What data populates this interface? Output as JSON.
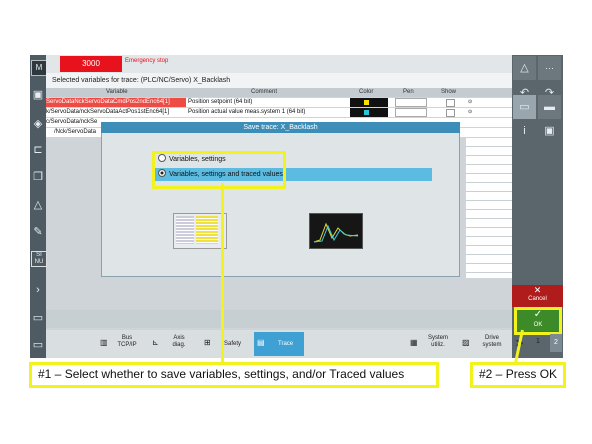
{
  "status": {
    "counter": "3000",
    "alarm": "Emergency stop"
  },
  "trace": {
    "title": "Selected variables for trace: (PLC/NC/Servo) X_Backlash",
    "columns": [
      "Variable",
      "Comment",
      "Color",
      "Pen",
      "Show"
    ],
    "rows": [
      {
        "variable": "ServoDataNckServoDataCmdPos2ndEnc64[1]",
        "comment": "Position setpoint (64 bit)"
      },
      {
        "variable": "k/ServoData/nckServoDataActPos1stEnc64[1]",
        "comment": "Position actual value meas.system 1 (64 bit)"
      },
      {
        "variable": "c/ServoData/nckSe",
        "comment": ""
      },
      {
        "variable": "/Nck/ServoData",
        "comment": ""
      }
    ]
  },
  "dialog": {
    "title": "Save trace:  X_Backlash",
    "option1": "Variables, settings",
    "option2": "Variables, settings and traced values"
  },
  "softkeys": {
    "bus": "Bus\nTCP/IP",
    "axis": "Axis\ndiag.",
    "safety": "Safety",
    "trace": "Trace",
    "sysutil": "System\nutiliz.",
    "drive": "Drive\nsystem",
    "next": ">",
    "p1": "1",
    "p2": "2"
  },
  "sidebar": {
    "cancel": "Cancel",
    "ok": "OK"
  },
  "annotations": {
    "step1": "#1 – Select whether to save variables, settings, and/or Traced values",
    "step2": "#2 – Press OK"
  },
  "colors": {
    "highlight": "#f2f21c",
    "alarm": "#e8121c",
    "ok": "#3d8b28",
    "cancel": "#b01c1c",
    "dialog_title": "#3c8eb8"
  }
}
